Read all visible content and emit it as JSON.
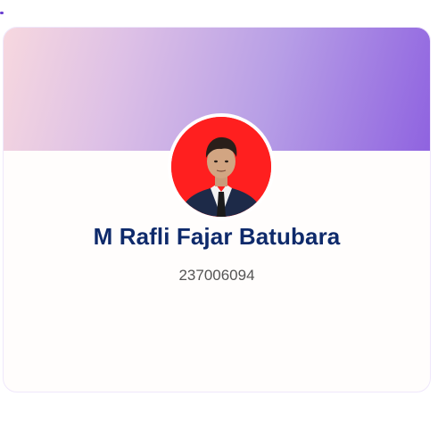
{
  "profile": {
    "name": "M Rafli Fajar Batubara",
    "id_number": "237006094",
    "avatar_background": "#ff1f1f"
  },
  "theme": {
    "banner_gradient": [
      "#f7d8df",
      "#ddc0e6",
      "#b79ee6",
      "#8f63e0"
    ],
    "name_color": "#0e2a6b",
    "id_color": "#555555"
  }
}
